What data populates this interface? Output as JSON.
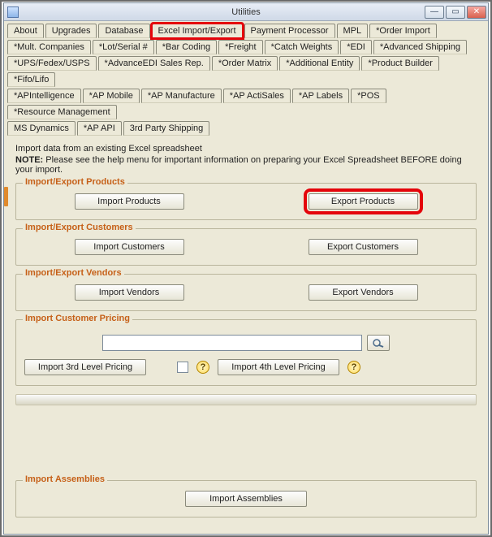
{
  "window": {
    "title": "Utilities"
  },
  "tabs": {
    "row1": [
      "About",
      "Upgrades",
      "Database",
      "Excel Import/Export",
      "Payment Processor",
      "MPL",
      "*Order Import"
    ],
    "row2": [
      "*Mult. Companies",
      "*Lot/Serial #",
      "*Bar Coding",
      "*Freight",
      "*Catch Weights",
      "*EDI",
      "*Advanced Shipping"
    ],
    "row3": [
      "*UPS/Fedex/USPS",
      "*AdvanceEDI Sales Rep.",
      "*Order Matrix",
      "*Additional Entity",
      "*Product Builder",
      "*Fifo/Lifo"
    ],
    "row4": [
      "*APIntelligence",
      "*AP Mobile",
      "*AP Manufacture",
      "*AP ActiSales",
      "*AP Labels",
      "*POS",
      "*Resource Management"
    ],
    "row5": [
      "MS Dynamics",
      "*AP API",
      "3rd Party Shipping"
    ],
    "highlighted_tab": "Excel Import/Export"
  },
  "intro": {
    "line1": "Import data from an existing Excel spreadsheet",
    "note_label": "NOTE:",
    "note_text": "Please see the help menu for important information on preparing your Excel Spreadsheet BEFORE doing your import."
  },
  "groups": {
    "products": {
      "title": "Import/Export Products",
      "import_btn": "Import Products",
      "export_btn": "Export Products"
    },
    "customers": {
      "title": "Import/Export Customers",
      "import_btn": "Import Customers",
      "export_btn": "Export Customers"
    },
    "vendors": {
      "title": "Import/Export Vendors",
      "import_btn": "Import Vendors",
      "export_btn": "Export Vendors"
    },
    "pricing": {
      "title": "Import Customer Pricing",
      "import3_btn": "Import 3rd Level Pricing",
      "import4_btn": "Import 4th Level Pricing",
      "help": "?"
    },
    "assemblies": {
      "title": "Import Assemblies",
      "import_btn": "Import Assemblies"
    }
  },
  "highlight_color": "#e4040b"
}
